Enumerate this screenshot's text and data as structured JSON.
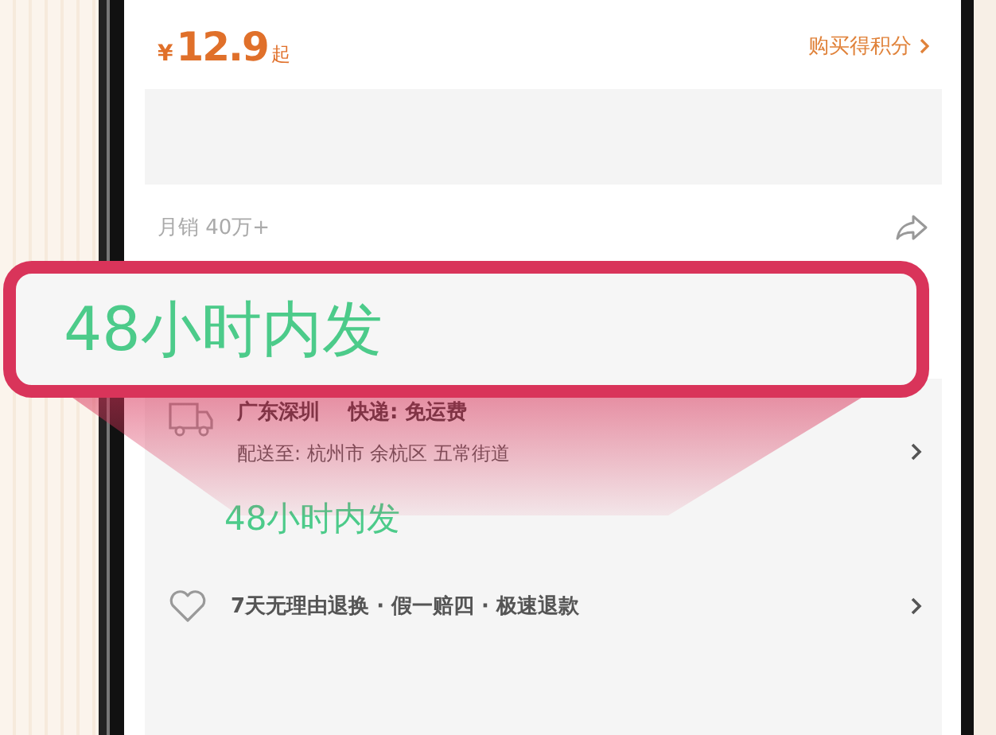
{
  "price": {
    "currency": "¥",
    "amount": "12.9",
    "suffix": "起"
  },
  "points_link": "购买得积分",
  "monthly_sales": "月销 40万+",
  "callout": {
    "text": "48小时内发"
  },
  "shipping": {
    "origin": "广东深圳",
    "delivery": "快递: 免运费",
    "address": "配送至: 杭州市 余杭区 五常街道"
  },
  "dispatch_note": "48小时内发",
  "guarantee": "7天无理由退换 · 假一赔四 · 极速退款"
}
